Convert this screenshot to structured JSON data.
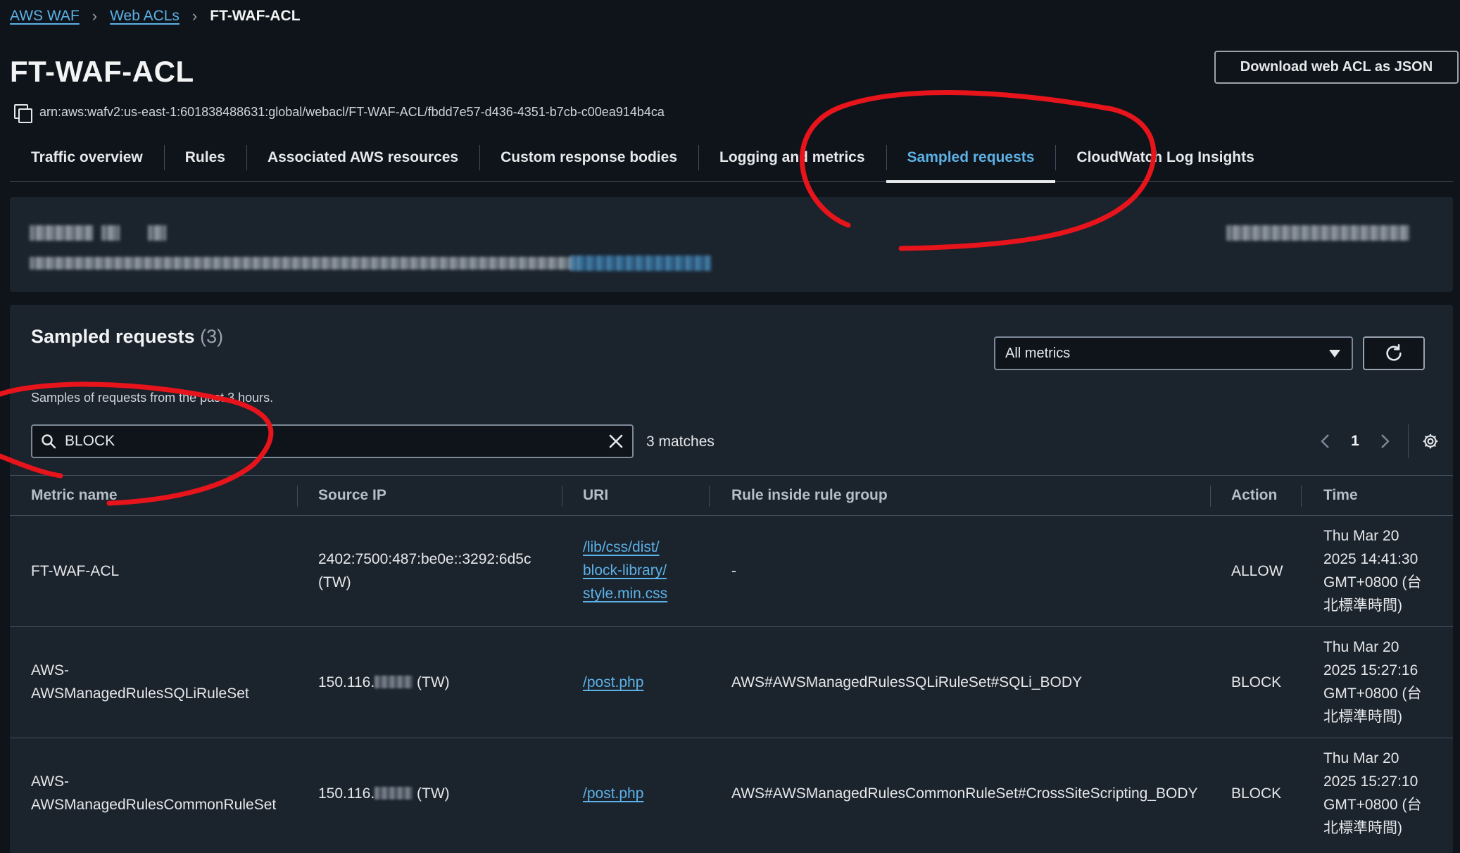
{
  "breadcrumb": {
    "root": "AWS WAF",
    "parent": "Web ACLs",
    "current": "FT-WAF-ACL"
  },
  "header": {
    "title": "FT-WAF-ACL",
    "download_label": "Download web ACL as JSON",
    "arn": "arn:aws:wafv2:us-east-1:601838488631:global/webacl/FT-WAF-ACL/fbdd7e57-d436-4351-b7cb-c00ea914b4ca"
  },
  "tabs": [
    {
      "label": "Traffic overview"
    },
    {
      "label": "Rules"
    },
    {
      "label": "Associated AWS resources"
    },
    {
      "label": "Custom response bodies"
    },
    {
      "label": "Logging and metrics"
    },
    {
      "label": "Sampled requests"
    },
    {
      "label": "CloudWatch Log Insights"
    }
  ],
  "active_tab": "Sampled requests",
  "sampled": {
    "title": "Sampled requests",
    "count": "(3)",
    "description": "Samples of requests from the past 3 hours.",
    "metric_select": "All metrics",
    "search_value": "BLOCK",
    "matches": "3 matches",
    "page": "1"
  },
  "table": {
    "columns": [
      "Metric name",
      "Source IP",
      "URI",
      "Rule inside rule group",
      "Action",
      "Time"
    ],
    "rows": [
      {
        "metric": [
          "FT-WAF-ACL"
        ],
        "source_ip": [
          "2402:7500:487:be0e::3292:6d5c",
          "(TW)"
        ],
        "uri": [
          "/lib/css/dist/",
          "block-library/",
          "style.min.css"
        ],
        "rule": "-",
        "action": "ALLOW",
        "time": [
          "Thu Mar 20",
          "2025 14:41:30",
          "GMT+0800 (台",
          "北標準時間)"
        ]
      },
      {
        "metric": [
          "AWS-",
          "AWSManagedRulesSQLiRuleSet"
        ],
        "source_ip_prefix": "150.116.",
        "source_ip_suffix": "(TW)",
        "uri": [
          "/post.php"
        ],
        "rule": "AWS#AWSManagedRulesSQLiRuleSet#SQLi_BODY",
        "action": "BLOCK",
        "time": [
          "Thu Mar 20",
          "2025 15:27:16",
          "GMT+0800 (台",
          "北標準時間)"
        ]
      },
      {
        "metric": [
          "AWS-",
          "AWSManagedRulesCommonRuleSet"
        ],
        "source_ip_prefix": "150.116.",
        "source_ip_suffix": "(TW)",
        "uri": [
          "/post.php"
        ],
        "rule": "AWS#AWSManagedRulesCommonRuleSet#CrossSiteScripting_BODY",
        "action": "BLOCK",
        "time": [
          "Thu Mar 20",
          "2025 15:27:10",
          "GMT+0800 (台",
          "北標準時間)"
        ]
      }
    ]
  },
  "colors": {
    "link": "#5cb1e6",
    "annotation": "#e8141c",
    "background": "#0f141a",
    "panel": "#1b232d"
  },
  "icons": [
    "copy-icon",
    "search-icon",
    "clear-icon",
    "refresh-icon",
    "chevron-left-icon",
    "chevron-right-icon",
    "gear-icon",
    "caret-down-icon"
  ]
}
